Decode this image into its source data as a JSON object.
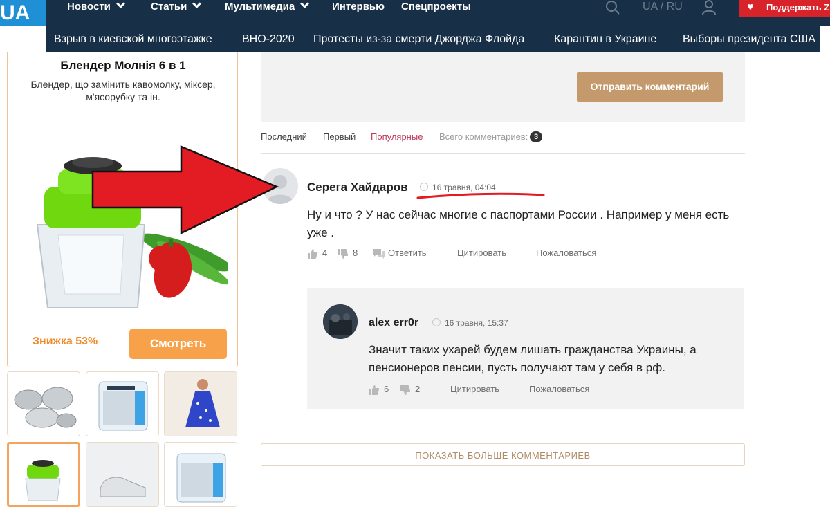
{
  "nav": {
    "logo": "UA",
    "items": [
      {
        "label": "Новости",
        "dropdown": true
      },
      {
        "label": "Статьи",
        "dropdown": true
      },
      {
        "label": "Мультимедиа",
        "dropdown": true
      },
      {
        "label": "Интервью",
        "dropdown": false
      },
      {
        "label": "Спецпроекты",
        "dropdown": false
      }
    ],
    "lang": "UA / RU",
    "support_label": "Поддержать ZN",
    "icons": {
      "search": "search-icon",
      "user": "user-icon",
      "support": "heart-hands-icon"
    }
  },
  "subnav": {
    "items": [
      "Взрыв в киевской многоэтажке",
      "ВНО-2020",
      "Протесты из-за смерти Джорджа Флойда",
      "Карантин в Украине",
      "Выборы президента США"
    ]
  },
  "ad": {
    "title": "Блендер Молнія 6 в 1",
    "description": "Блендер, що замінить кавомолку, міксер, м'ясорубку та ін.",
    "discount": "Знижка 53%",
    "button": "Смотреть"
  },
  "comments_section": {
    "submit_label": "Отправить комментарий",
    "sort": {
      "latest": "Последний",
      "first": "Первый",
      "popular": "Популярные"
    },
    "total_label": "Всего комментариев:",
    "total_count": "3",
    "show_more": "ПОКАЗАТЬ БОЛЬШЕ КОММЕНТАРИЕВ"
  },
  "comment": {
    "author": "Серега Хайдаров",
    "date": "16 травня, 04:04",
    "text": "Ну и что ? У нас сейчас многие с паспортами России . Например у меня есть уже .",
    "likes": "4",
    "dislikes": "8",
    "reply": "Ответить",
    "quote": "Цитировать",
    "report": "Пожаловаться"
  },
  "reply": {
    "author": "alex err0r",
    "date": "16 травня, 15:37",
    "text": "Значит таких ухарей будем лишать гражданства Украины, а пенсионеров пенсии, пусть получают там у себя в рф.",
    "likes": "6",
    "dislikes": "2",
    "quote": "Цитировать",
    "report": "Пожаловаться"
  },
  "colors": {
    "nav_bg": "#183047",
    "support_red": "#d8232a",
    "submit_tan": "#c49a6c",
    "ad_orange": "#f7a24a",
    "popular_pink": "#c0395b",
    "annotation_red": "#e31b23"
  }
}
